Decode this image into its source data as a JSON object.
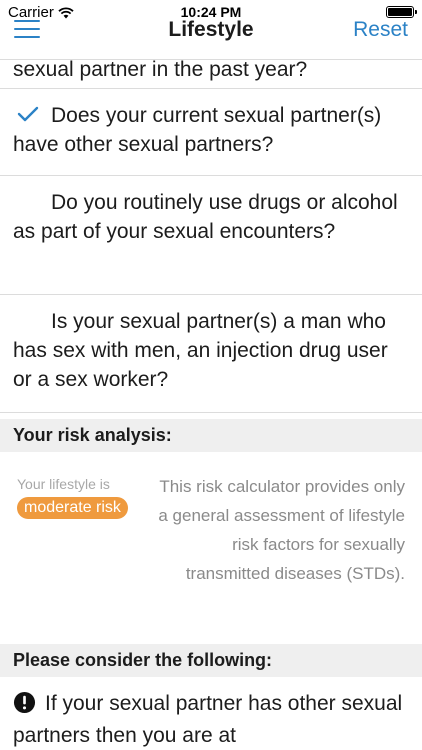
{
  "status_bar": {
    "carrier": "Carrier",
    "time": "10:24 PM"
  },
  "nav": {
    "title": "Lifestyle",
    "reset_label": "Reset",
    "accent_color": "#2b82c6"
  },
  "questions": [
    {
      "text": "sexual partner in the past year?",
      "checked": false
    },
    {
      "text": "Does your current sexual partner(s) have other sexual partners?",
      "checked": true
    },
    {
      "text": "Do you routinely use drugs or alcohol as part of your sexual encounters?",
      "checked": false
    },
    {
      "text": "Is your sexual partner(s) a man who has sex with men, an injection drug user or a sex worker?",
      "checked": false
    }
  ],
  "risk_section": {
    "header": "Your risk analysis:",
    "lifestyle_label": "Your lifestyle is",
    "risk_level": "moderate risk",
    "risk_color": "#ef9a3e",
    "disclaimer": "This risk calculator provides only a general assessment of lifestyle risk factors for sexually transmitted diseases (STDs)."
  },
  "consider_section": {
    "header": "Please consider the following:",
    "items": [
      {
        "icon": "exclamation-circle-icon",
        "text": "If your sexual partner has other sexual partners then you are at"
      }
    ]
  }
}
